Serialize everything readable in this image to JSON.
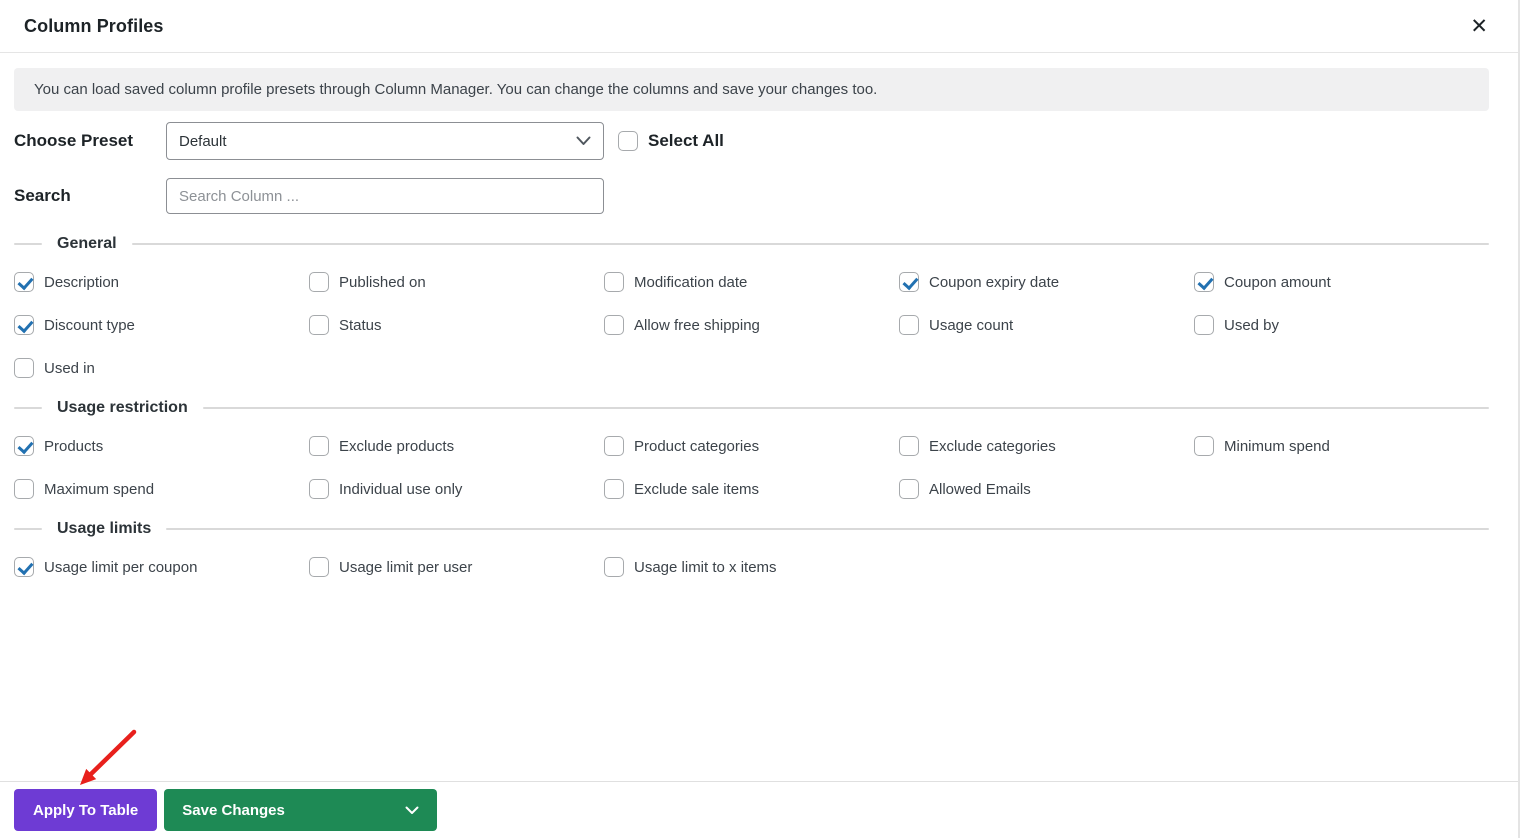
{
  "modal": {
    "title": "Column Profiles",
    "close_glyph": "✕"
  },
  "banner": {
    "text": "You can load saved column profile presets through Column Manager. You can change the columns and save your changes too."
  },
  "preset": {
    "label": "Choose Preset",
    "value": "Default",
    "select_all_label": "Select All",
    "select_all_checked": false
  },
  "search": {
    "label": "Search",
    "placeholder": "Search Column ..."
  },
  "sections": [
    {
      "title": "General",
      "items": [
        {
          "label": "Description",
          "checked": true
        },
        {
          "label": "Published on",
          "checked": false
        },
        {
          "label": "Modification date",
          "checked": false
        },
        {
          "label": "Coupon expiry date",
          "checked": true
        },
        {
          "label": "Coupon amount",
          "checked": true
        },
        {
          "label": "Discount type",
          "checked": true
        },
        {
          "label": "Status",
          "checked": false
        },
        {
          "label": "Allow free shipping",
          "checked": false
        },
        {
          "label": "Usage count",
          "checked": false
        },
        {
          "label": "Used by",
          "checked": false
        },
        {
          "label": "Used in",
          "checked": false
        }
      ]
    },
    {
      "title": "Usage restriction",
      "items": [
        {
          "label": "Products",
          "checked": true
        },
        {
          "label": "Exclude products",
          "checked": false
        },
        {
          "label": "Product categories",
          "checked": false
        },
        {
          "label": "Exclude categories",
          "checked": false
        },
        {
          "label": "Minimum spend",
          "checked": false
        },
        {
          "label": "Maximum spend",
          "checked": false
        },
        {
          "label": "Individual use only",
          "checked": false
        },
        {
          "label": "Exclude sale items",
          "checked": false
        },
        {
          "label": "Allowed Emails",
          "checked": false
        }
      ]
    },
    {
      "title": "Usage limits",
      "items": [
        {
          "label": "Usage limit per coupon",
          "checked": true
        },
        {
          "label": "Usage limit per user",
          "checked": false
        },
        {
          "label": "Usage limit to x items",
          "checked": false
        }
      ]
    }
  ],
  "footer": {
    "apply_label": "Apply To Table",
    "save_label": "Save Changes"
  },
  "colors": {
    "accent_purple": "#6e3bd4",
    "accent_green": "#1e8a55",
    "check_blue": "#2271b1",
    "arrow_red": "#e8201c",
    "banner_bg": "#f0f0f1"
  }
}
